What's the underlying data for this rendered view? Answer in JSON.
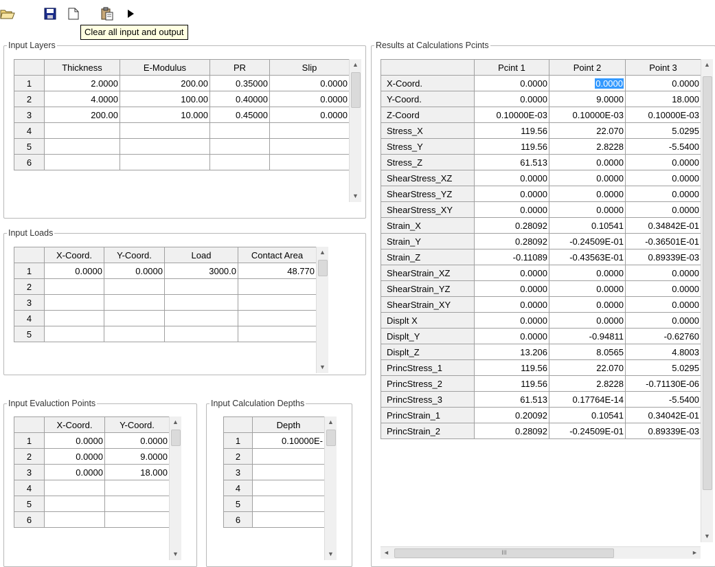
{
  "toolbar": {
    "tooltip": "Clear all input and output"
  },
  "layers": {
    "title": "Input Layers",
    "headers": [
      "Thickness",
      "E-Modulus",
      "PR",
      "Slip"
    ],
    "rows": [
      {
        "n": "1",
        "v": [
          "2.0000",
          "200.00",
          "0.35000",
          "0.0000"
        ]
      },
      {
        "n": "2",
        "v": [
          "4.0000",
          "100.00",
          "0.40000",
          "0.0000"
        ]
      },
      {
        "n": "3",
        "v": [
          "200.00",
          "10.000",
          "0.45000",
          "0.0000"
        ]
      },
      {
        "n": "4",
        "v": [
          "",
          "",
          "",
          ""
        ]
      },
      {
        "n": "5",
        "v": [
          "",
          "",
          "",
          ""
        ]
      },
      {
        "n": "6",
        "v": [
          "",
          "",
          "",
          ""
        ]
      }
    ]
  },
  "loads": {
    "title": "Input Loads",
    "headers": [
      "X-Coord.",
      "Y-Coord.",
      "Load",
      "Contact Area"
    ],
    "rows": [
      {
        "n": "1",
        "v": [
          "0.0000",
          "0.0000",
          "3000.0",
          "48.770"
        ]
      },
      {
        "n": "2",
        "v": [
          "",
          "",
          "",
          ""
        ]
      },
      {
        "n": "3",
        "v": [
          "",
          "",
          "",
          ""
        ]
      },
      {
        "n": "4",
        "v": [
          "",
          "",
          "",
          ""
        ]
      },
      {
        "n": "5",
        "v": [
          "",
          "",
          "",
          ""
        ]
      }
    ]
  },
  "evaluation": {
    "title": "Input Evaluction Points",
    "headers": [
      "X-Coord.",
      "Y-Coord."
    ],
    "rows": [
      {
        "n": "1",
        "v": [
          "0.0000",
          "0.0000"
        ]
      },
      {
        "n": "2",
        "v": [
          "0.0000",
          "9.0000"
        ]
      },
      {
        "n": "3",
        "v": [
          "0.0000",
          "18.000"
        ]
      },
      {
        "n": "4",
        "v": [
          "",
          ""
        ]
      },
      {
        "n": "5",
        "v": [
          "",
          ""
        ]
      },
      {
        "n": "6",
        "v": [
          "",
          ""
        ]
      }
    ]
  },
  "depths": {
    "title": "Input Calculation Depths",
    "headers": [
      "Depth"
    ],
    "rows": [
      {
        "n": "1",
        "v": [
          "0.10000E-"
        ]
      },
      {
        "n": "2",
        "v": [
          ""
        ]
      },
      {
        "n": "3",
        "v": [
          ""
        ]
      },
      {
        "n": "4",
        "v": [
          ""
        ]
      },
      {
        "n": "5",
        "v": [
          ""
        ]
      },
      {
        "n": "6",
        "v": [
          ""
        ]
      }
    ]
  },
  "results": {
    "title": "Results at Calculations Pcints",
    "headers": [
      "Pcint 1",
      "Point 2",
      "Point 3"
    ],
    "rows": [
      {
        "n": "X-Coord.",
        "v": [
          "0.0000",
          "0.0000",
          "0.0000"
        ]
      },
      {
        "n": "Y-Coord.",
        "v": [
          "0.0000",
          "9.0000",
          "18.000"
        ]
      },
      {
        "n": "Z-Coord",
        "v": [
          "0.10000E-03",
          "0.10000E-03",
          "0.10000E-03"
        ]
      },
      {
        "n": "Stress_X",
        "v": [
          "119.56",
          "22.070",
          "5.0295"
        ]
      },
      {
        "n": "Stress_Y",
        "v": [
          "119.56",
          "2.8228",
          "-5.5400"
        ]
      },
      {
        "n": "Stress_Z",
        "v": [
          "61.513",
          "0.0000",
          "0.0000"
        ]
      },
      {
        "n": "ShearStress_XZ",
        "v": [
          "0.0000",
          "0.0000",
          "0.0000"
        ]
      },
      {
        "n": "ShearStress_YZ",
        "v": [
          "0.0000",
          "0.0000",
          "0.0000"
        ]
      },
      {
        "n": "ShearStress_XY",
        "v": [
          "0.0000",
          "0.0000",
          "0.0000"
        ]
      },
      {
        "n": "Strain_X",
        "v": [
          "0.28092",
          "0.10541",
          "0.34842E-01"
        ]
      },
      {
        "n": "Strain_Y",
        "v": [
          "0.28092",
          "-0.24509E-01",
          "-0.36501E-01"
        ]
      },
      {
        "n": "Strain_Z",
        "v": [
          "-0.11089",
          "-0.43563E-01",
          "0.89339E-03"
        ]
      },
      {
        "n": "ShearStrain_XZ",
        "v": [
          "0.0000",
          "0.0000",
          "0.0000"
        ]
      },
      {
        "n": "ShearStrain_YZ",
        "v": [
          "0.0000",
          "0.0000",
          "0.0000"
        ]
      },
      {
        "n": "ShearStrain_XY",
        "v": [
          "0.0000",
          "0.0000",
          "0.0000"
        ]
      },
      {
        "n": "Displt X",
        "v": [
          "0.0000",
          "0.0000",
          "0.0000"
        ]
      },
      {
        "n": "Displt_Y",
        "v": [
          "0.0000",
          "-0.94811",
          "-0.62760"
        ]
      },
      {
        "n": "Displt_Z",
        "v": [
          "13.206",
          "8.0565",
          "4.8003"
        ]
      },
      {
        "n": "PrincStress_1",
        "v": [
          "119.56",
          "22.070",
          "5.0295"
        ]
      },
      {
        "n": "PrincStress_2",
        "v": [
          "119.56",
          "2.8228",
          "-0.71130E-06"
        ]
      },
      {
        "n": "PrincStress_3",
        "v": [
          "61.513",
          "0.17764E-14",
          "-5.5400"
        ]
      },
      {
        "n": "PrincStrain_1",
        "v": [
          "0.20092",
          "0.10541",
          "0.34042E-01"
        ]
      },
      {
        "n": "PrincStrain_2",
        "v": [
          "0.28092",
          "-0.24509E-01",
          "0.89339E-03"
        ]
      }
    ],
    "hscroll_label": "III"
  }
}
